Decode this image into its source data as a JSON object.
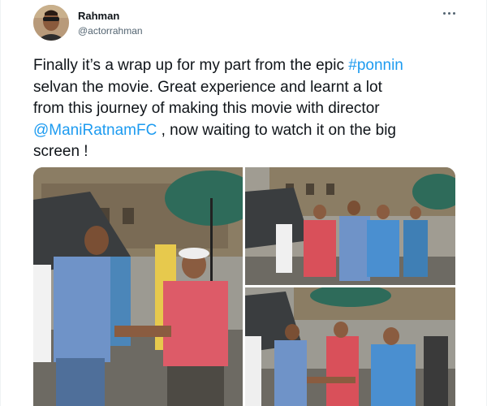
{
  "tweet": {
    "author_name": "Rahman",
    "author_handle": "@actorrahman",
    "text_lines": [
      [
        {
          "t": "Finally it’s a wrap up for my part from the epic "
        },
        {
          "t": "#ponnin",
          "link": true
        }
      ],
      [
        {
          "t": "selvan the movie. Great experience and learnt a lot"
        }
      ],
      [
        {
          "t": "from this journey of making this movie with director"
        }
      ],
      [
        {
          "t": "@ManiRatnamFC",
          "link": true
        },
        {
          "t": "  , now waiting to watch it on the big"
        }
      ],
      [
        {
          "t": "screen !"
        }
      ]
    ]
  },
  "icons": {
    "more": "more-horizontal-icon",
    "avatar": "avatar-photo"
  },
  "colors": {
    "link": "#1d9bf0",
    "text": "#0f1419",
    "secondary": "#536471"
  }
}
